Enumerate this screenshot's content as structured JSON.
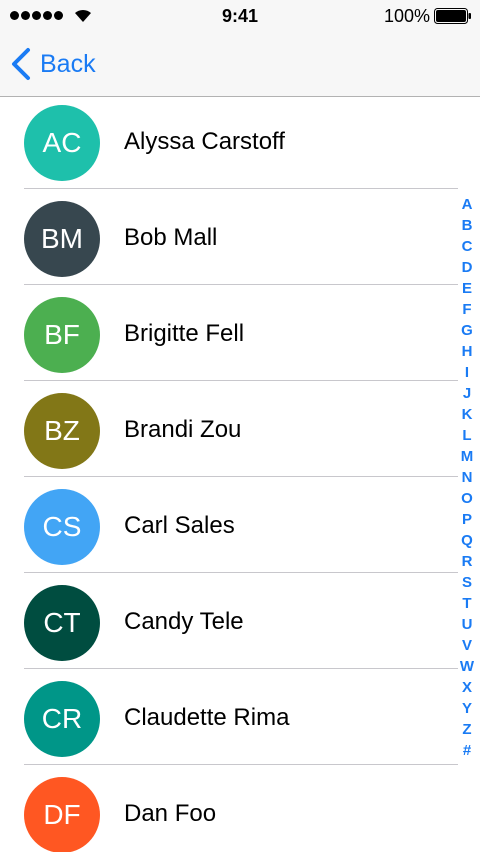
{
  "status_bar": {
    "time": "9:41",
    "battery_percent": "100%",
    "signal_bars": 5,
    "wifi_icon": "wifi-icon",
    "battery_icon": "battery-icon"
  },
  "nav": {
    "back_label": "Back",
    "back_icon": "chevron-left-icon",
    "accent_color": "#1a7bf4"
  },
  "contacts": [
    {
      "initials": "AC",
      "name": "Alyssa Carstoff",
      "color": "#1ec0ab"
    },
    {
      "initials": "BM",
      "name": "Bob Mall",
      "color": "#37474f"
    },
    {
      "initials": "BF",
      "name": "Brigitte Fell",
      "color": "#4caf50"
    },
    {
      "initials": "BZ",
      "name": "Brandi Zou",
      "color": "#827717"
    },
    {
      "initials": "CS",
      "name": "Carl Sales",
      "color": "#42a5f5"
    },
    {
      "initials": "CT",
      "name": "Candy Tele",
      "color": "#004d40"
    },
    {
      "initials": "CR",
      "name": "Claudette Rima",
      "color": "#009688"
    },
    {
      "initials": "DF",
      "name": "Dan Foo",
      "color": "#ff5722"
    }
  ],
  "index_letters": [
    "A",
    "B",
    "C",
    "D",
    "E",
    "F",
    "G",
    "H",
    "I",
    "J",
    "K",
    "L",
    "M",
    "N",
    "O",
    "P",
    "Q",
    "R",
    "S",
    "T",
    "U",
    "V",
    "W",
    "X",
    "Y",
    "Z",
    "#"
  ]
}
